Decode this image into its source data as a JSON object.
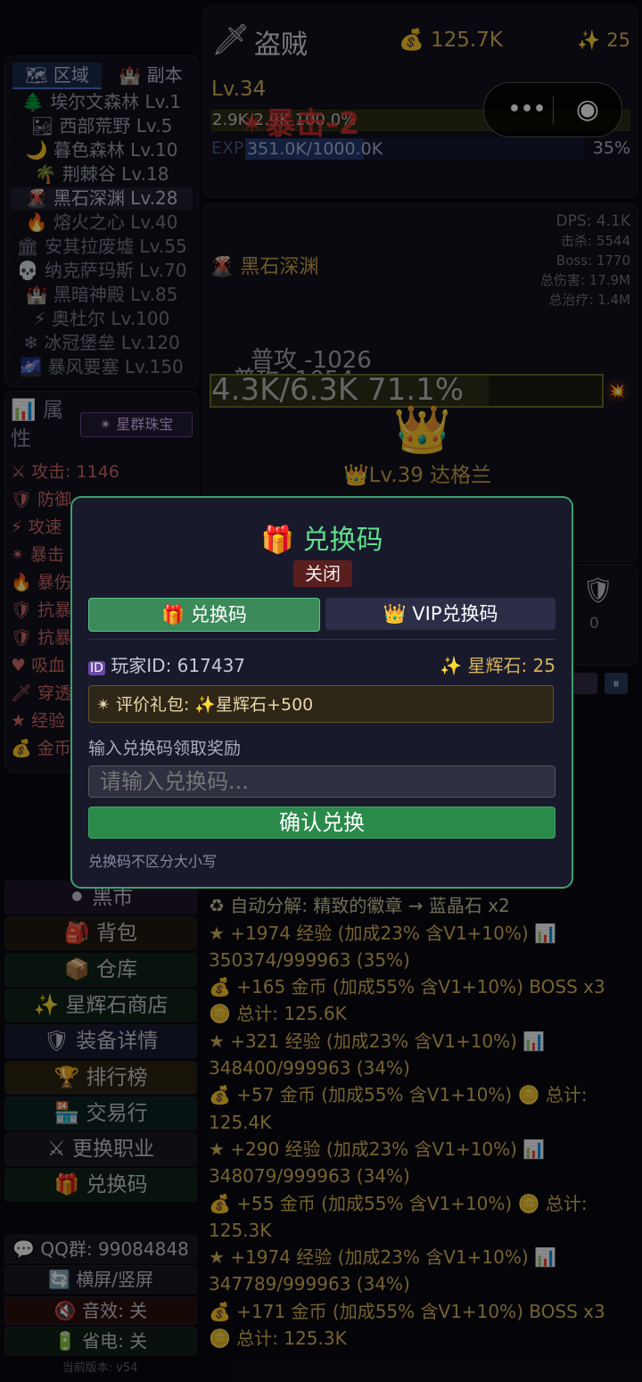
{
  "header": {
    "class_icon": "dagger-icon",
    "class_name": "盗贼",
    "gold": "125.7K",
    "stars": "25",
    "level": "Lv.34",
    "hp_text": "2.9K/2.9K 100.0%",
    "crit_float": "✴暴击-2",
    "exp_label": "EXP",
    "exp_text": "351.0K/1000.0K",
    "exp_pct": "35%",
    "exp_fraction": 0.351
  },
  "capsule": {
    "more": "•••",
    "close": "◉"
  },
  "sidebar": {
    "tabs": [
      {
        "label": "区域",
        "icon": "map-icon"
      },
      {
        "label": "副本",
        "icon": "dungeon-icon"
      }
    ],
    "zones": [
      {
        "icon": "🌲",
        "label": "埃尔文森林 Lv.1"
      },
      {
        "icon": "🏜",
        "label": "西部荒野 Lv.5"
      },
      {
        "icon": "🌙",
        "label": "暮色森林 Lv.10"
      },
      {
        "icon": "🌴",
        "label": "荆棘谷 Lv.18"
      },
      {
        "icon": "🌋",
        "label": "黑石深渊 Lv.28"
      },
      {
        "icon": "🔥",
        "label": "熔火之心 Lv.40"
      },
      {
        "icon": "🏛",
        "label": "安其拉废墟 Lv.55"
      },
      {
        "icon": "💀",
        "label": "纳克萨玛斯 Lv.70"
      },
      {
        "icon": "🏰",
        "label": "黑暗神殿 Lv.85"
      },
      {
        "icon": "⚡",
        "label": "奥杜尔 Lv.100"
      },
      {
        "icon": "❄",
        "label": "冰冠堡垒 Lv.120"
      },
      {
        "icon": "🌌",
        "label": "暴风要塞 Lv.150"
      }
    ],
    "attr_title": "属性",
    "attr_icon": "📊",
    "gem_button": "✴ 星群珠宝",
    "stats": [
      {
        "icon": "⚔",
        "label": "攻击: 1146"
      },
      {
        "icon": "🛡",
        "label": "防御"
      },
      {
        "icon": "⚡",
        "label": "攻速"
      },
      {
        "icon": "✴",
        "label": "暴击"
      },
      {
        "icon": "🔥",
        "label": "暴伤"
      },
      {
        "icon": "🛡",
        "label": "抗暴"
      },
      {
        "icon": "🛡",
        "label": "抗暴"
      },
      {
        "icon": "♥",
        "label": "吸血"
      },
      {
        "icon": "🗡",
        "label": "穿透"
      },
      {
        "icon": "★",
        "label": "经验"
      },
      {
        "icon": "💰",
        "label": "金币"
      }
    ],
    "menu": [
      {
        "icon": "⚫",
        "label": "黑市",
        "bg": "#20152a"
      },
      {
        "icon": "🎒",
        "label": "背包",
        "bg": "#201910"
      },
      {
        "icon": "📦",
        "label": "仓库",
        "bg": "#0f2418"
      },
      {
        "icon": "✨",
        "label": "星辉石商店",
        "bg": "#0f2418"
      },
      {
        "icon": "🛡",
        "label": "装备详情",
        "bg": "#181a33"
      },
      {
        "icon": "🏆",
        "label": "排行榜",
        "bg": "#2a2410"
      },
      {
        "icon": "🏪",
        "label": "交易行",
        "bg": "#0e2422"
      },
      {
        "icon": "⚔",
        "label": "更换职业",
        "bg": "#181822"
      },
      {
        "icon": "🎁",
        "label": "兑换码",
        "bg": "#0f2418"
      }
    ],
    "qq": "💬 QQ群: 99084848",
    "orientation": "🔄 横屏/竖屏",
    "sound": "🔇 音效: 关",
    "power": "🔋 省电: 关",
    "version": "当前版本: v54"
  },
  "zone_panel": {
    "name": "黑石深渊",
    "dps": "DPS: 4.1K",
    "kills": "击杀: 5544",
    "boss": "Boss: 1770",
    "total_dmg": "总伤害: 17.9M",
    "total_heal": "总治疗: 1.4M",
    "dmg1": "普攻 -1026",
    "dmg2": "普攻 -1054",
    "boss_hp": "4.3K/6.3K  71.1%",
    "boss_hp_fraction": 0.711,
    "boss_name": "Lv.39 达格兰",
    "right_count": "0"
  },
  "log": [
    {
      "cls": "gold",
      "text": "125.6K"
    },
    {
      "cls": "xp",
      "text": "♻ 自动分解: 精致的徽章 → 蓝晶石 x2"
    },
    {
      "cls": "gold",
      "text": "★ +1974 经验 (加成23% 含V1+10%) 📊"
    },
    {
      "cls": "gold",
      "text": "350374/999963 (35%)"
    },
    {
      "cls": "gold",
      "text": "💰 +165 金币 (加成55% 含V1+10%) BOSS x3"
    },
    {
      "cls": "gold",
      "text": "🪙 总计: 125.6K"
    },
    {
      "cls": "gold",
      "text": "★ +321 经验 (加成23% 含V1+10%) 📊"
    },
    {
      "cls": "gold",
      "text": "348400/999963 (34%)"
    },
    {
      "cls": "gold",
      "text": "💰 +57 金币 (加成55% 含V1+10%) 🪙 总计:"
    },
    {
      "cls": "gold",
      "text": "125.4K"
    },
    {
      "cls": "gold",
      "text": "★ +290 经验 (加成23% 含V1+10%) 📊"
    },
    {
      "cls": "gold",
      "text": "348079/999963 (34%)"
    },
    {
      "cls": "gold",
      "text": "💰 +55 金币 (加成55% 含V1+10%) 🪙 总计:"
    },
    {
      "cls": "gold",
      "text": "125.3K"
    },
    {
      "cls": "gold",
      "text": "★ +1974 经验 (加成23% 含V1+10%) 📊"
    },
    {
      "cls": "gold",
      "text": "347789/999963 (34%)"
    },
    {
      "cls": "gold",
      "text": "💰 +171 金币 (加成55% 含V1+10%) BOSS x3"
    },
    {
      "cls": "gold",
      "text": "🪙 总计: 125.3K"
    }
  ],
  "modal": {
    "title": "兑换码",
    "close": "关闭",
    "tab_code": "兑换码",
    "tab_vip": "VIP兑换码",
    "player_id": "玩家ID: 617437",
    "stars": "星辉石: 25",
    "review_gift": "✴ 评价礼包: ✨星辉石+500",
    "instruction": "输入兑换码领取奖励",
    "placeholder": "请输入兑换码...",
    "confirm": "确认兑换",
    "note": "兑换码不区分大小写"
  }
}
